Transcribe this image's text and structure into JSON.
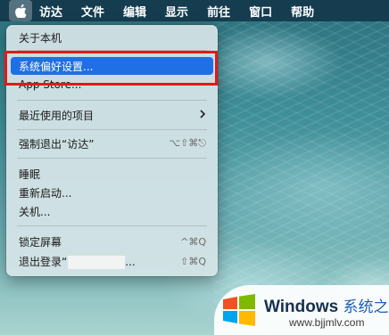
{
  "menubar": {
    "items": [
      "访达",
      "文件",
      "编辑",
      "显示",
      "前往",
      "窗口",
      "帮助"
    ]
  },
  "apple_menu": {
    "items": [
      {
        "label": "关于本机"
      },
      {
        "label": "系统偏好设置...",
        "highlighted": true
      },
      {
        "label": "App Store..."
      },
      {
        "label": "最近使用的项目",
        "submenu": true
      },
      {
        "label": "强制退出“访达”",
        "shortcut": "⌥⇧⌘⎋"
      },
      {
        "label": "睡眠"
      },
      {
        "label": "重新启动..."
      },
      {
        "label": "关机..."
      },
      {
        "label": "锁定屏幕",
        "shortcut": "^⌘Q"
      },
      {
        "label": "退出登录“",
        "label_end": "...",
        "shortcut": "⇧⌘Q"
      }
    ]
  },
  "watermark": {
    "brand": "Windows",
    "brand_cn": "系统之家",
    "url": "www.bjjmlv.com"
  },
  "colors": {
    "highlight": "#1f6fe5",
    "annotation": "#e5171b",
    "menubar": "#14374b"
  },
  "icons": {
    "apple": "apple-logo-icon",
    "submenu": "chevron-right-icon",
    "watermark_logo": "windows-logo-icon"
  }
}
